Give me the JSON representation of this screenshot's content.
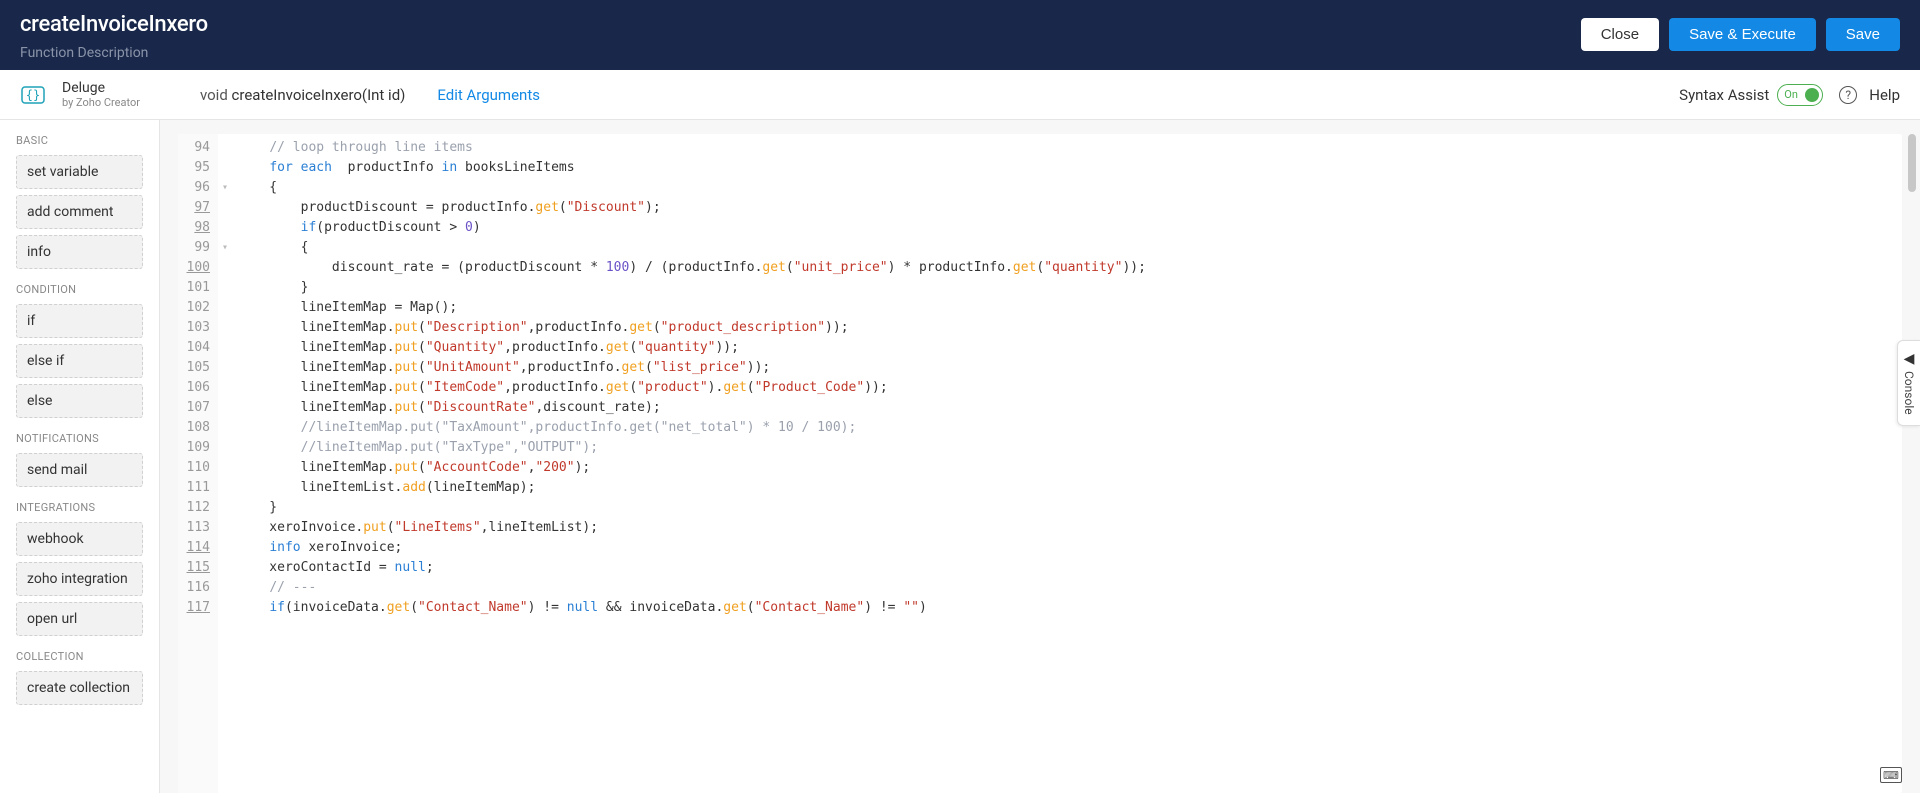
{
  "header": {
    "title": "createInvoiceInxero",
    "subtitle": "Function Description",
    "close": "Close",
    "saveExecute": "Save & Execute",
    "save": "Save"
  },
  "subheader": {
    "delugeName": "Deluge",
    "delugeSub": "by Zoho Creator",
    "signatureReturn": "void",
    "signatureName": "createInvoiceInxero(Int id)",
    "editArgs": "Edit Arguments",
    "syntaxAssist": "Syntax Assist",
    "toggleState": "On",
    "help": "Help"
  },
  "sidebar": {
    "groups": [
      {
        "title": "BASIC",
        "items": [
          "set variable",
          "add comment",
          "info"
        ]
      },
      {
        "title": "CONDITION",
        "items": [
          "if",
          "else if",
          "else"
        ]
      },
      {
        "title": "NOTIFICATIONS",
        "items": [
          "send mail"
        ]
      },
      {
        "title": "INTEGRATIONS",
        "items": [
          "webhook",
          "zoho integration",
          "open url"
        ]
      },
      {
        "title": "COLLECTION",
        "items": [
          "create collection"
        ]
      }
    ]
  },
  "editor": {
    "startLine": 94,
    "underlinedLines": [
      97,
      98,
      100,
      114,
      115,
      117
    ],
    "foldMarkers": {
      "96": "▾",
      "99": "▾"
    },
    "lines": [
      {
        "n": 94,
        "tokens": [
          {
            "t": "    ",
            "c": ""
          },
          {
            "t": "// loop through line items",
            "c": "c-comment"
          }
        ]
      },
      {
        "n": 95,
        "tokens": [
          {
            "t": "    ",
            "c": ""
          },
          {
            "t": "for each",
            "c": "c-kw"
          },
          {
            "t": "  productInfo ",
            "c": ""
          },
          {
            "t": "in",
            "c": "c-kw"
          },
          {
            "t": " booksLineItems",
            "c": ""
          }
        ]
      },
      {
        "n": 96,
        "tokens": [
          {
            "t": "    {",
            "c": ""
          }
        ]
      },
      {
        "n": 97,
        "tokens": [
          {
            "t": "        productDiscount = productInfo.",
            "c": ""
          },
          {
            "t": "get",
            "c": "c-fn"
          },
          {
            "t": "(",
            "c": ""
          },
          {
            "t": "\"Discount\"",
            "c": "c-str"
          },
          {
            "t": ");",
            "c": ""
          }
        ]
      },
      {
        "n": 98,
        "tokens": [
          {
            "t": "        ",
            "c": ""
          },
          {
            "t": "if",
            "c": "c-kw"
          },
          {
            "t": "(productDiscount > ",
            "c": ""
          },
          {
            "t": "0",
            "c": "c-num"
          },
          {
            "t": ")",
            "c": ""
          }
        ]
      },
      {
        "n": 99,
        "tokens": [
          {
            "t": "        {",
            "c": ""
          }
        ]
      },
      {
        "n": 100,
        "tokens": [
          {
            "t": "            discount_rate = (productDiscount * ",
            "c": ""
          },
          {
            "t": "100",
            "c": "c-num"
          },
          {
            "t": ") / (productInfo.",
            "c": ""
          },
          {
            "t": "get",
            "c": "c-fn"
          },
          {
            "t": "(",
            "c": ""
          },
          {
            "t": "\"unit_price\"",
            "c": "c-str"
          },
          {
            "t": ") * productInfo.",
            "c": ""
          },
          {
            "t": "get",
            "c": "c-fn"
          },
          {
            "t": "(",
            "c": ""
          },
          {
            "t": "\"quantity\"",
            "c": "c-str"
          },
          {
            "t": "));",
            "c": ""
          }
        ]
      },
      {
        "n": 101,
        "tokens": [
          {
            "t": "        }",
            "c": ""
          }
        ]
      },
      {
        "n": 102,
        "tokens": [
          {
            "t": "        lineItemMap = Map();",
            "c": ""
          }
        ]
      },
      {
        "n": 103,
        "tokens": [
          {
            "t": "        lineItemMap.",
            "c": ""
          },
          {
            "t": "put",
            "c": "c-fn"
          },
          {
            "t": "(",
            "c": ""
          },
          {
            "t": "\"Description\"",
            "c": "c-str"
          },
          {
            "t": ",productInfo.",
            "c": ""
          },
          {
            "t": "get",
            "c": "c-fn"
          },
          {
            "t": "(",
            "c": ""
          },
          {
            "t": "\"product_description\"",
            "c": "c-str"
          },
          {
            "t": "));",
            "c": ""
          }
        ]
      },
      {
        "n": 104,
        "tokens": [
          {
            "t": "        lineItemMap.",
            "c": ""
          },
          {
            "t": "put",
            "c": "c-fn"
          },
          {
            "t": "(",
            "c": ""
          },
          {
            "t": "\"Quantity\"",
            "c": "c-str"
          },
          {
            "t": ",productInfo.",
            "c": ""
          },
          {
            "t": "get",
            "c": "c-fn"
          },
          {
            "t": "(",
            "c": ""
          },
          {
            "t": "\"quantity\"",
            "c": "c-str"
          },
          {
            "t": "));",
            "c": ""
          }
        ]
      },
      {
        "n": 105,
        "tokens": [
          {
            "t": "        lineItemMap.",
            "c": ""
          },
          {
            "t": "put",
            "c": "c-fn"
          },
          {
            "t": "(",
            "c": ""
          },
          {
            "t": "\"UnitAmount\"",
            "c": "c-str"
          },
          {
            "t": ",productInfo.",
            "c": ""
          },
          {
            "t": "get",
            "c": "c-fn"
          },
          {
            "t": "(",
            "c": ""
          },
          {
            "t": "\"list_price\"",
            "c": "c-str"
          },
          {
            "t": "));",
            "c": ""
          }
        ]
      },
      {
        "n": 106,
        "tokens": [
          {
            "t": "        lineItemMap.",
            "c": ""
          },
          {
            "t": "put",
            "c": "c-fn"
          },
          {
            "t": "(",
            "c": ""
          },
          {
            "t": "\"ItemCode\"",
            "c": "c-str"
          },
          {
            "t": ",productInfo.",
            "c": ""
          },
          {
            "t": "get",
            "c": "c-fn"
          },
          {
            "t": "(",
            "c": ""
          },
          {
            "t": "\"product\"",
            "c": "c-str"
          },
          {
            "t": ").",
            "c": ""
          },
          {
            "t": "get",
            "c": "c-fn"
          },
          {
            "t": "(",
            "c": ""
          },
          {
            "t": "\"Product_Code\"",
            "c": "c-str"
          },
          {
            "t": "));",
            "c": ""
          }
        ]
      },
      {
        "n": 107,
        "tokens": [
          {
            "t": "        lineItemMap.",
            "c": ""
          },
          {
            "t": "put",
            "c": "c-fn"
          },
          {
            "t": "(",
            "c": ""
          },
          {
            "t": "\"DiscountRate\"",
            "c": "c-str"
          },
          {
            "t": ",discount_rate);",
            "c": ""
          }
        ]
      },
      {
        "n": 108,
        "tokens": [
          {
            "t": "        ",
            "c": ""
          },
          {
            "t": "//lineItemMap.put(\"TaxAmount\",productInfo.get(\"net_total\") * 10 / 100);",
            "c": "c-comment"
          }
        ]
      },
      {
        "n": 109,
        "tokens": [
          {
            "t": "        ",
            "c": ""
          },
          {
            "t": "//lineItemMap.put(\"TaxType\",\"OUTPUT\");",
            "c": "c-comment"
          }
        ]
      },
      {
        "n": 110,
        "tokens": [
          {
            "t": "        lineItemMap.",
            "c": ""
          },
          {
            "t": "put",
            "c": "c-fn"
          },
          {
            "t": "(",
            "c": ""
          },
          {
            "t": "\"AccountCode\"",
            "c": "c-str"
          },
          {
            "t": ",",
            "c": ""
          },
          {
            "t": "\"200\"",
            "c": "c-str"
          },
          {
            "t": ");",
            "c": ""
          }
        ]
      },
      {
        "n": 111,
        "tokens": [
          {
            "t": "        lineItemList.",
            "c": ""
          },
          {
            "t": "add",
            "c": "c-fn"
          },
          {
            "t": "(lineItemMap);",
            "c": ""
          }
        ]
      },
      {
        "n": 112,
        "tokens": [
          {
            "t": "    }",
            "c": ""
          }
        ]
      },
      {
        "n": 113,
        "tokens": [
          {
            "t": "    xeroInvoice.",
            "c": ""
          },
          {
            "t": "put",
            "c": "c-fn"
          },
          {
            "t": "(",
            "c": ""
          },
          {
            "t": "\"LineItems\"",
            "c": "c-str"
          },
          {
            "t": ",lineItemList);",
            "c": ""
          }
        ]
      },
      {
        "n": 114,
        "tokens": [
          {
            "t": "    ",
            "c": ""
          },
          {
            "t": "info",
            "c": "c-kw"
          },
          {
            "t": " xeroInvoice;",
            "c": ""
          }
        ]
      },
      {
        "n": 115,
        "tokens": [
          {
            "t": "    xeroContactId = ",
            "c": ""
          },
          {
            "t": "null",
            "c": "c-kw"
          },
          {
            "t": ";",
            "c": ""
          }
        ]
      },
      {
        "n": 116,
        "tokens": [
          {
            "t": "    ",
            "c": ""
          },
          {
            "t": "// ---",
            "c": "c-comment"
          }
        ]
      },
      {
        "n": 117,
        "tokens": [
          {
            "t": "    ",
            "c": ""
          },
          {
            "t": "if",
            "c": "c-kw"
          },
          {
            "t": "(invoiceData.",
            "c": ""
          },
          {
            "t": "get",
            "c": "c-fn"
          },
          {
            "t": "(",
            "c": ""
          },
          {
            "t": "\"Contact_Name\"",
            "c": "c-str"
          },
          {
            "t": ") != ",
            "c": ""
          },
          {
            "t": "null",
            "c": "c-kw"
          },
          {
            "t": " && invoiceData.",
            "c": ""
          },
          {
            "t": "get",
            "c": "c-fn"
          },
          {
            "t": "(",
            "c": ""
          },
          {
            "t": "\"Contact_Name\"",
            "c": "c-str"
          },
          {
            "t": ") != ",
            "c": ""
          },
          {
            "t": "\"\"",
            "c": "c-str"
          },
          {
            "t": ")",
            "c": ""
          }
        ]
      }
    ]
  },
  "consoleTab": "Console"
}
